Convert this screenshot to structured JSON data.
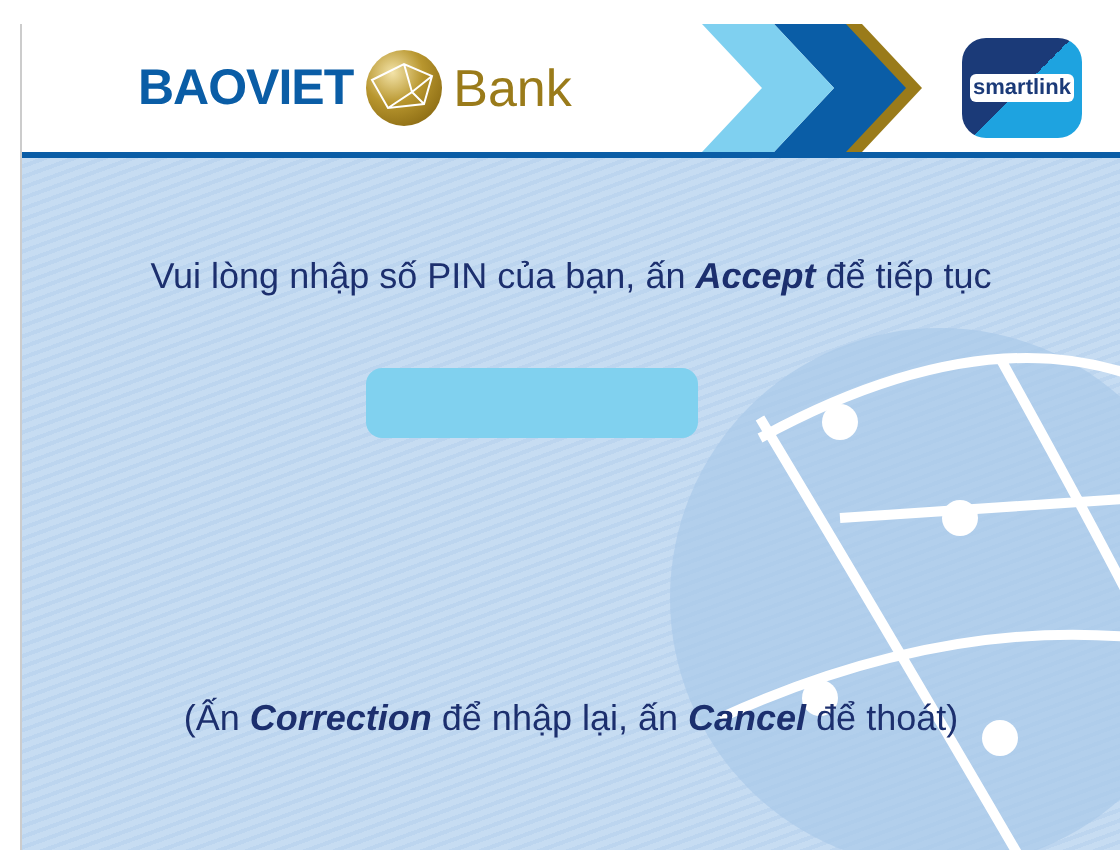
{
  "header": {
    "bank_name": "BAOVIET",
    "bank_suffix": "Bank",
    "partner_logo_text": "smartlink"
  },
  "prompt": "Vui lòng nhập số PIN của bạn, ấn **Accept** để tiếp tục",
  "hint": "(Ấn **Correction** để nhập lại, ấn **Cancel** để thoát)"
}
